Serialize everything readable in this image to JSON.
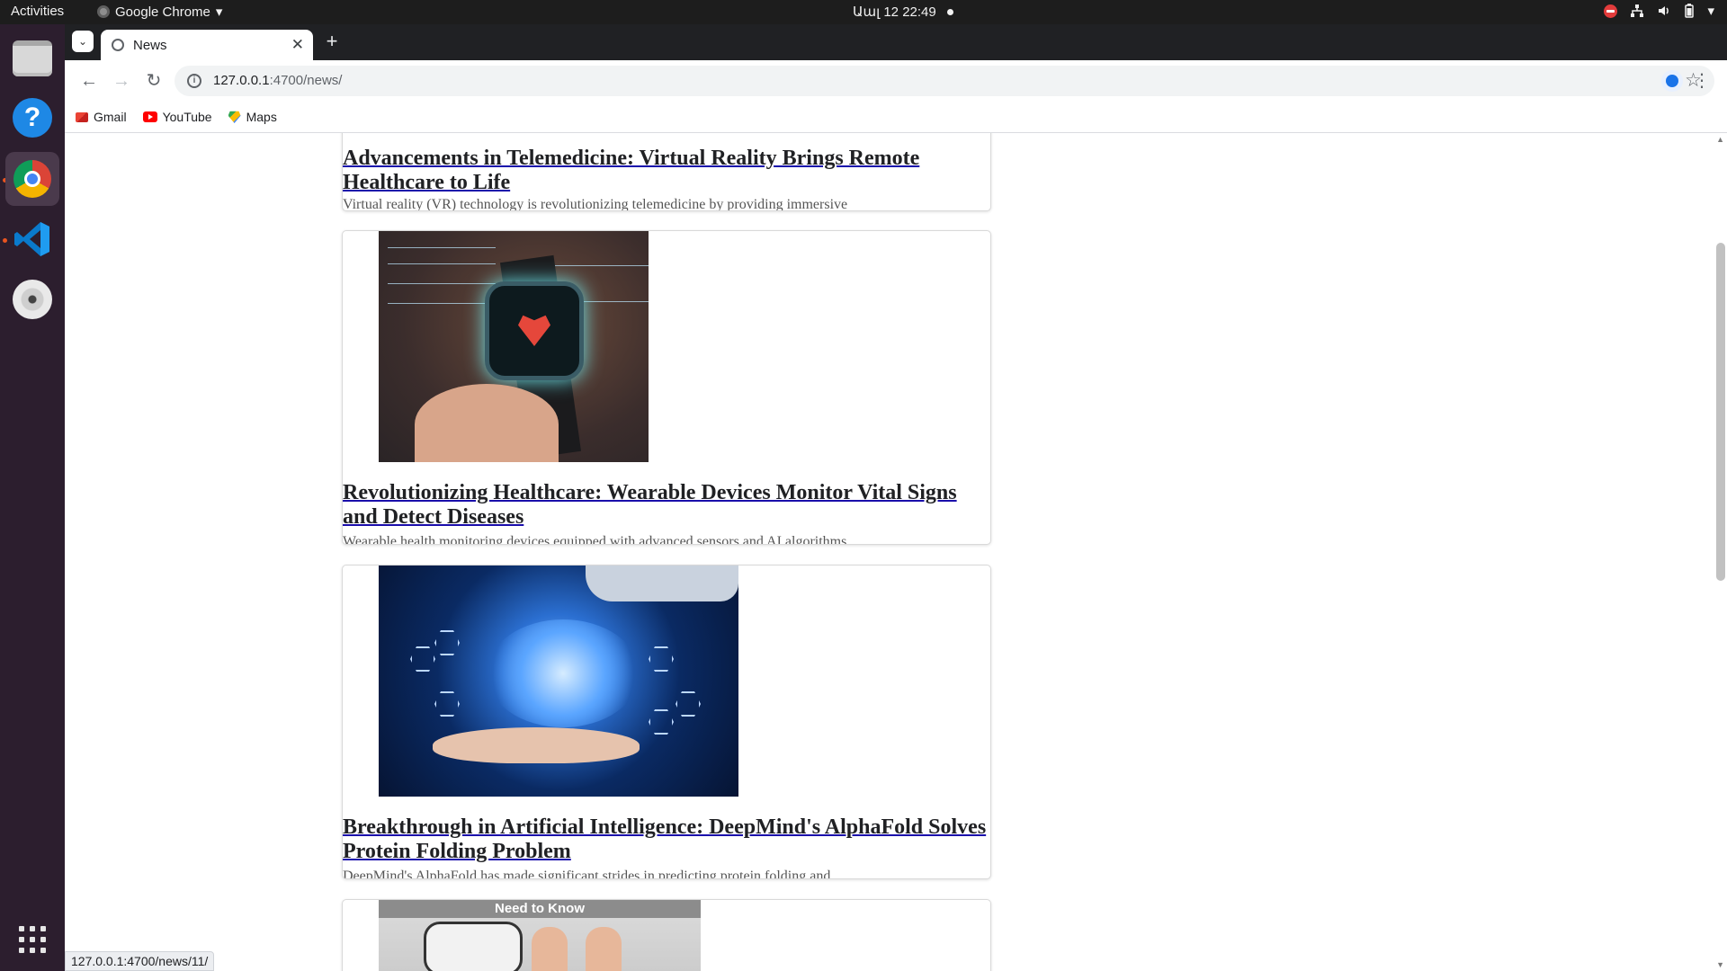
{
  "system_bar": {
    "activities": "Activities",
    "app_name": "Google Chrome",
    "clock": "Աալ 12  22:49"
  },
  "dock": {
    "items": [
      {
        "name": "files-icon"
      },
      {
        "name": "help-icon"
      },
      {
        "name": "chrome-icon",
        "active": true
      },
      {
        "name": "vscode-icon"
      },
      {
        "name": "dvd-icon"
      },
      {
        "name": "show-apps-icon"
      }
    ]
  },
  "browser": {
    "tab_title": "News",
    "new_tab_symbol": "+",
    "url_host": "127.0.0.1",
    "url_path": ":4700/news/",
    "bookmarks": [
      {
        "label": "Gmail",
        "icon": "gmail-icon"
      },
      {
        "label": "YouTube",
        "icon": "youtube-icon"
      },
      {
        "label": "Maps",
        "icon": "maps-icon"
      }
    ],
    "status_url": "127.0.0.1:4700/news/11/"
  },
  "news": {
    "articles": [
      {
        "title": "Advancements in Telemedicine: Virtual Reality Brings Remote Healthcare to Life",
        "snippet": "Virtual reality (VR) technology is revolutionizing telemedicine by providing immersive"
      },
      {
        "title": "Revolutionizing Healthcare: Wearable Devices Monitor Vital Signs and Detect Diseases",
        "snippet": "Wearable health monitoring devices equipped with advanced sensors and AI algorithms"
      },
      {
        "title": "Breakthrough in Artificial Intelligence: DeepMind's AlphaFold Solves Protein Folding Problem",
        "snippet": "DeepMind's AlphaFold has made significant strides in predicting protein folding and"
      },
      {
        "image_banner": "Need to Know"
      }
    ]
  }
}
